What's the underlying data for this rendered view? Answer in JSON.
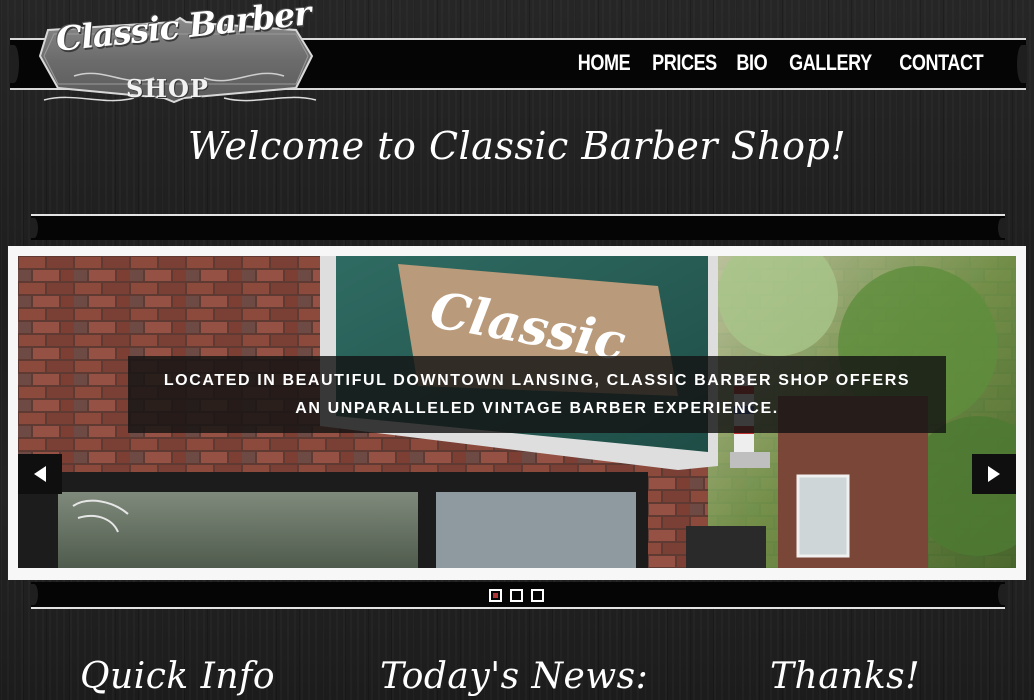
{
  "logo": {
    "line1": "Classic Barber",
    "line2": "SHOP"
  },
  "nav": {
    "items": [
      {
        "label": "HOME"
      },
      {
        "label": "PRICES"
      },
      {
        "label": "BIO"
      },
      {
        "label": "GALLERY"
      },
      {
        "label": "CONTACT"
      }
    ]
  },
  "welcome": {
    "title": "Welcome to Classic Barber Shop!"
  },
  "slider": {
    "caption": "Located in beautiful downtown Lansing, Classic Barber Shop offers an unparalleled vintage barber experience.",
    "sign_text": "Classic",
    "prev_icon": "arrow-left-icon",
    "next_icon": "arrow-right-icon",
    "slide_count": 3,
    "active_slide": 1
  },
  "sections": {
    "quick_info": "Quick Info",
    "todays_news": "Today's News:",
    "thanks": "Thanks!"
  },
  "colors": {
    "background": "#1e1e1e",
    "bar": "#050505",
    "active_dot": "#b03434",
    "text": "#ffffff"
  }
}
